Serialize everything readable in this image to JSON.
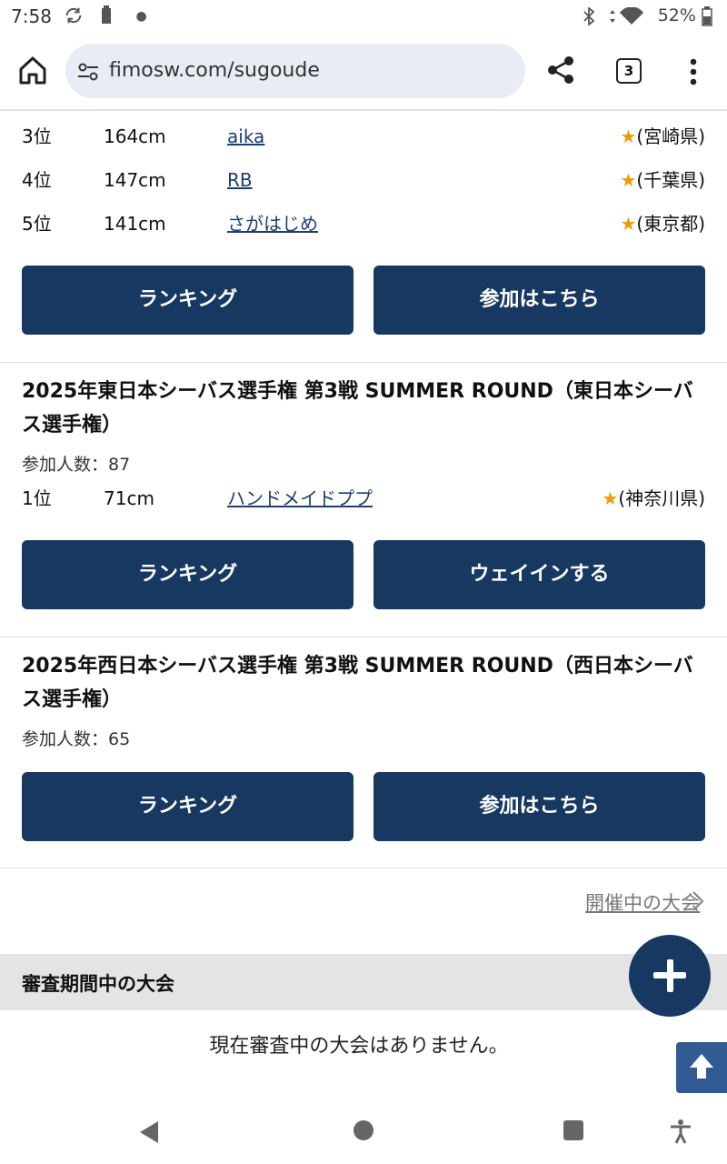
{
  "status_bar": {
    "time": "7:58",
    "battery": "52%"
  },
  "browser": {
    "url": "fimosw.com/sugoude",
    "tab_count": "3"
  },
  "top_results": [
    {
      "rank": "3位",
      "size": "164cm",
      "name": "aika",
      "star": "★",
      "pref": "(宮崎県)"
    },
    {
      "rank": "4位",
      "size": "147cm",
      "name": "RB",
      "star": "★",
      "pref": "(千葉県)"
    },
    {
      "rank": "5位",
      "size": "141cm",
      "name": "さがはじめ",
      "star": "★",
      "pref": "(東京都)"
    }
  ],
  "block1": {
    "ranking_label": "ランキング",
    "join_label": "参加はこちら"
  },
  "comp2": {
    "title": "2025年東日本シーバス選手権 第3戦 SUMMER ROUND（東日本シーバス選手権）",
    "participants": "参加人数：87",
    "result": {
      "rank": "1位",
      "size": "71cm",
      "name": "ハンドメイドププ",
      "star": "★",
      "pref": "(神奈川県)"
    },
    "ranking_label": "ランキング",
    "weighin_label": "ウェイインする"
  },
  "comp3": {
    "title": "2025年西日本シーバス選手権 第3戦 SUMMER ROUND（西日本シーバス選手権）",
    "participants": "参加人数：65",
    "ranking_label": "ランキング",
    "join_label": "参加はこちら"
  },
  "ongoing_link": "開催中の大会",
  "review_section": {
    "title": "審査期間中の大会",
    "empty_message": "現在審査中の大会はありません。"
  },
  "colors": {
    "button_bg": "#173861",
    "link": "#1d3e72",
    "star": "#f29b00"
  }
}
